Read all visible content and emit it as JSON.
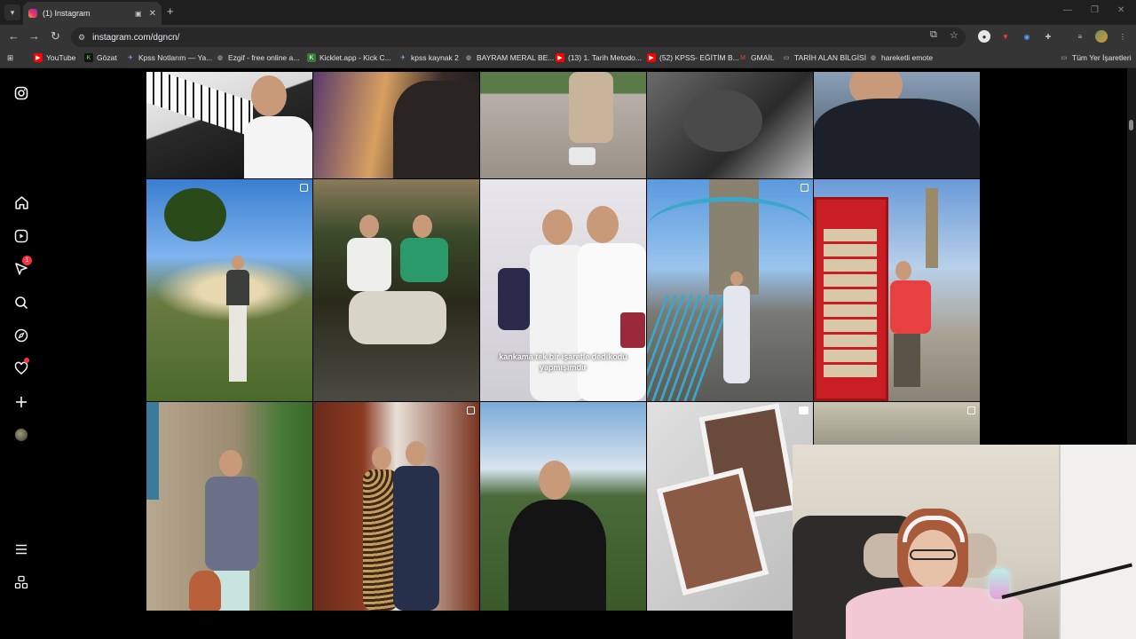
{
  "browser": {
    "tab_title": "(1) Instagram",
    "url": "instagram.com/dgncn/",
    "bookmarks": [
      {
        "label": "YouTube",
        "color": "#ff0000"
      },
      {
        "label": "Gözat",
        "color": "#53fc18"
      },
      {
        "label": "Kpss Notlarım — Ya...",
        "color": "#4a7bd0"
      },
      {
        "label": "Ezgif - free online a...",
        "color": "#9aa0a6"
      },
      {
        "label": "Kicklet.app - Kick C...",
        "color": "#3a7a3a"
      },
      {
        "label": "kpss kaynak 2",
        "color": "#4a7bd0"
      },
      {
        "label": "BAYRAM MERAL BE...",
        "color": "#9aa0a6"
      },
      {
        "label": "(13) 1. Tarih Metodo...",
        "color": "#ff0000"
      },
      {
        "label": "(52) KPSS- EĞİTİM B...",
        "color": "#ff0000"
      },
      {
        "label": "GMAİL",
        "color": "#ea4335"
      },
      {
        "label": "TARİH ALAN BİLGİSİ",
        "color": "#9aa0a6"
      },
      {
        "label": "hareketli emote",
        "color": "#9aa0a6"
      }
    ],
    "all_bookmarks_label": "Tüm Yer İşaretleri"
  },
  "sidebar": {
    "notification_badge": "1"
  },
  "posts": {
    "caption_reel_3": "kankama tek bir işaretle dedikodu yapmışımdır"
  }
}
